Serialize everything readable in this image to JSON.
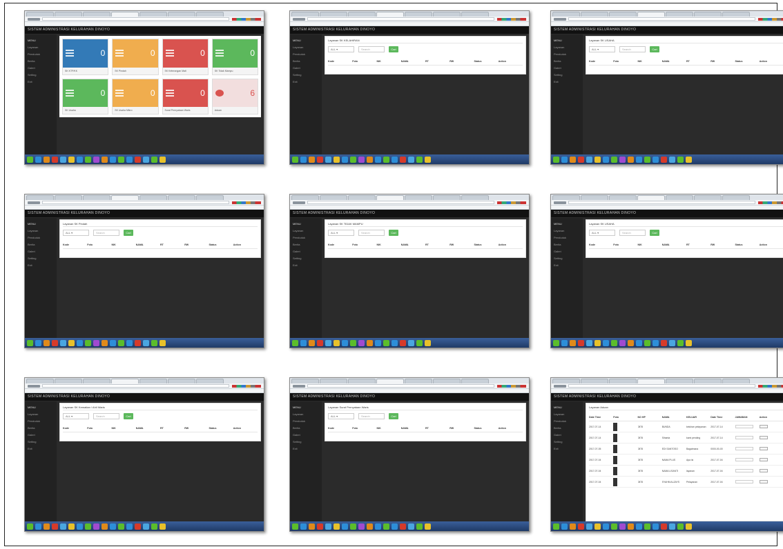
{
  "app_title": "SISTEM ADMINISTRASI KELURAHAN DINOYO",
  "sidebar": [
    "MENU",
    "Layanan",
    "Penduduk",
    "Berita",
    "Galeri",
    "Setting",
    "Exit"
  ],
  "filter": {
    "select": "ALL",
    "search": "Search",
    "button": "Cari"
  },
  "table_headers": [
    "Kode",
    "Foto",
    "NIK",
    "NAMA",
    "RT",
    "RW",
    "Status",
    "Action"
  ],
  "screens": [
    {
      "kind": "dashboard",
      "tiles": [
        {
          "value": "0",
          "label": "SK KTP/KK",
          "color": "#337ab7"
        },
        {
          "value": "0",
          "label": "SK Pindah",
          "color": "#f0ad4e"
        },
        {
          "value": "0",
          "label": "SK Keterangan Mati",
          "color": "#d9534f"
        },
        {
          "value": "0",
          "label": "SK Tidak Mampu",
          "color": "#5cb85c"
        },
        {
          "value": "0",
          "label": "SK Usaha",
          "color": "#5cb85c"
        },
        {
          "value": "0",
          "label": "SK Usaha Mikro",
          "color": "#f0ad4e"
        },
        {
          "value": "0",
          "label": "Surat Pernyataan Waris",
          "color": "#d9534f"
        },
        {
          "value": "6",
          "label": "Aduan",
          "color": "#d9534f"
        }
      ]
    },
    {
      "kind": "list",
      "title": "Layanan SK KELAHIRAN"
    },
    {
      "kind": "list",
      "title": "Layanan SK USAHA"
    },
    {
      "kind": "list",
      "title": "Layanan SK Pindah"
    },
    {
      "kind": "list",
      "title": "Layanan SK TIDAK MAMPU"
    },
    {
      "kind": "list",
      "title": "Layanan SK USAHA"
    },
    {
      "kind": "list",
      "title": "Layanan SK Kematian / Ahli Waris"
    },
    {
      "kind": "list",
      "title": "Layanan Surat Pernyataan Waris"
    },
    {
      "kind": "aduan",
      "title": "Layanan Aduan",
      "headers": [
        "Date Time",
        "Foto",
        "NO HP",
        "NAMA",
        "KELUAR",
        "Date Time",
        "JAWABAN",
        "Action"
      ],
      "rows": [
        [
          "2017-07-14",
          "",
          "0878",
          "BUNDA",
          "keluhan pelayanan",
          "2017-07-14",
          "",
          "JAWAB"
        ],
        [
          "2017-07-14",
          "",
          "0878",
          "Sihanta",
          "kami pending",
          "2017-07-14",
          "",
          "JAWAB"
        ],
        [
          "2017-07-05",
          "",
          "0878",
          "EDI SANTOSO",
          "Bagaimana",
          "0000-00-00",
          "",
          "JAWAB"
        ],
        [
          "2017-07-04",
          "",
          "0878",
          "NAMA PLUS",
          "Apa isi",
          "2017-07-04",
          "",
          "JAWAB"
        ],
        [
          "2017-07-04",
          "",
          "0878",
          "NAMA LISANTI",
          "layanan",
          "2017-07-04",
          "",
          "JAWAB"
        ],
        [
          "2017-07-04",
          "",
          "0878",
          "SYAHM ALZAYS",
          "Pelayanan",
          "2017-07-04",
          "",
          "JAWAB"
        ]
      ]
    }
  ]
}
